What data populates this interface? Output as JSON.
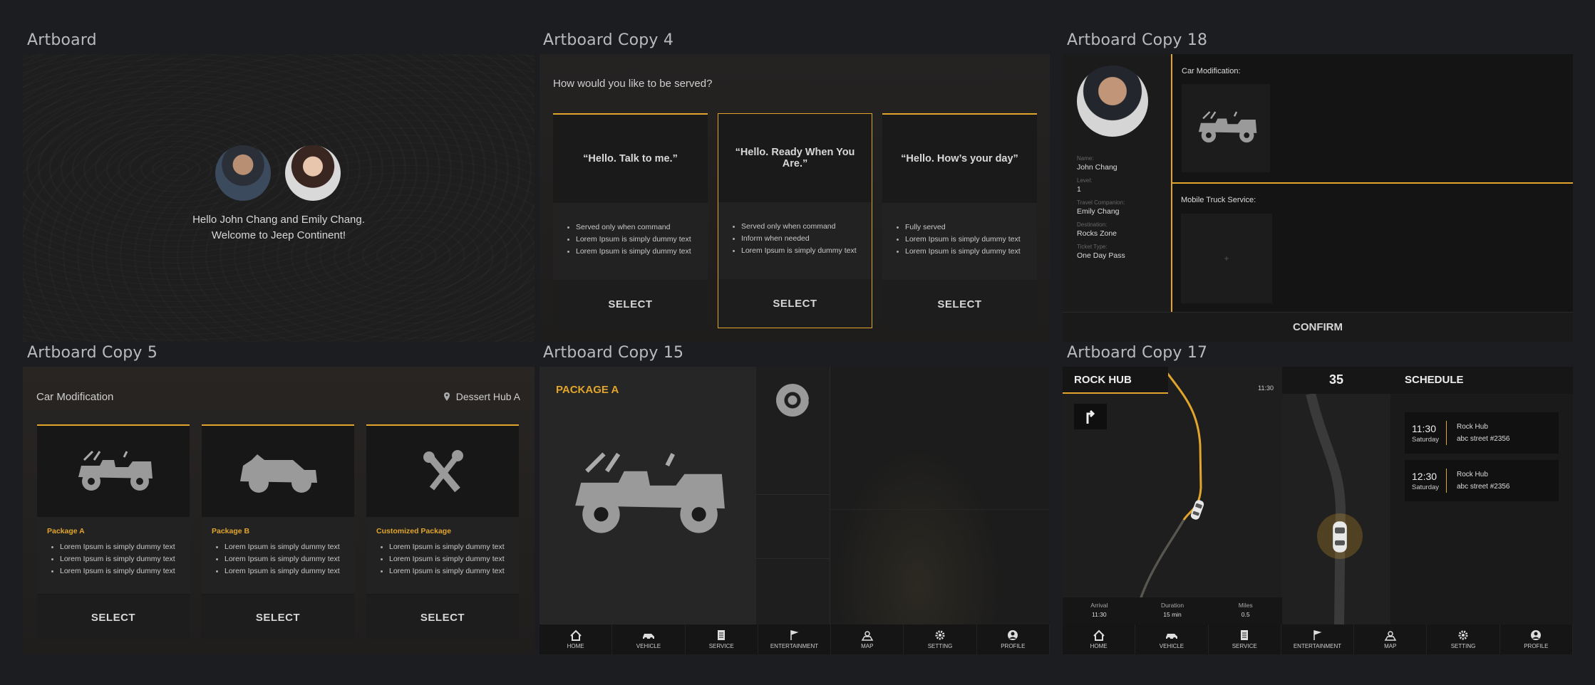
{
  "artboards": {
    "a1": {
      "title": "Artboard",
      "greeting_line1": "Hello John Chang and Emily Chang.",
      "greeting_line2": "Welcome to Jeep Continent!"
    },
    "a2": {
      "title": "Artboard Copy 4",
      "question": "How would you like to be served?",
      "cards": [
        {
          "quote": "“Hello. Talk to me.”",
          "bullets": [
            "Served only when command",
            "Lorem Ipsum is simply dummy text",
            "Lorem Ipsum is simply dummy text"
          ],
          "button": "SELECT"
        },
        {
          "quote": "“Hello. Ready When You Are.”",
          "bullets": [
            "Served only when command",
            "Inform when needed",
            "Lorem Ipsum is simply dummy text"
          ],
          "button": "SELECT"
        },
        {
          "quote": "“Hello. How’s your day”",
          "bullets": [
            "Fully served",
            "Lorem Ipsum is simply dummy text",
            "Lorem Ipsum is simply dummy text"
          ],
          "button": "SELECT"
        }
      ]
    },
    "a3": {
      "title": "Artboard Copy 18",
      "fields": [
        {
          "label": "Name:",
          "value": "John Chang"
        },
        {
          "label": "Level:",
          "value": "1"
        },
        {
          "label": "Travel Companion:",
          "value": "Emily Chang"
        },
        {
          "label": "Destination:",
          "value": "Rocks Zone"
        },
        {
          "label": "Ticket Type:",
          "value": "One Day Pass"
        }
      ],
      "car_mod_label": "Car Modification:",
      "mobile_truck_label": "Mobile Truck Service:",
      "add_symbol": "+",
      "confirm": "CONFIRM"
    },
    "a4": {
      "title": "Artboard Copy 5",
      "heading": "Car Modification",
      "location": "Dessert Hub A",
      "cards": [
        {
          "name": "Package A",
          "bullets": [
            "Lorem Ipsum is simply dummy text",
            "Lorem Ipsum is simply dummy text",
            "Lorem Ipsum is simply dummy text"
          ],
          "button": "SELECT"
        },
        {
          "name": "Package B",
          "bullets": [
            "Lorem Ipsum is simply dummy text",
            "Lorem Ipsum is simply dummy text",
            "Lorem Ipsum is simply dummy text"
          ],
          "button": "SELECT"
        },
        {
          "name": "Customized Package",
          "bullets": [
            "Lorem Ipsum is simply dummy text",
            "Lorem Ipsum is simply dummy text",
            "Lorem Ipsum is simply dummy text"
          ],
          "button": "SELECT"
        }
      ]
    },
    "a5": {
      "title": "Artboard Copy 15",
      "package": "PACKAGE A"
    },
    "a6": {
      "title": "Artboard Copy 17",
      "rock_hub": "ROCK HUB",
      "time_small": "11:30",
      "speed": "35",
      "schedule": "SCHEDULE",
      "stats": [
        {
          "label": "Arrival",
          "value": "11:30"
        },
        {
          "label": "Duration",
          "value": "15 min"
        },
        {
          "label": "Miles",
          "value": "0.5"
        }
      ],
      "schedule_items": [
        {
          "time": "11:30",
          "day": "Saturday",
          "place": "Rock Hub",
          "address": "abc street #2356"
        },
        {
          "time": "12:30",
          "day": "Saturday",
          "place": "Rock Hub",
          "address": "abc street #2356"
        }
      ]
    }
  },
  "nav": [
    {
      "label": "HOME",
      "icon": "home-icon"
    },
    {
      "label": "VEHICLE",
      "icon": "vehicle-icon"
    },
    {
      "label": "SERVICE",
      "icon": "service-icon"
    },
    {
      "label": "ENTERTAINMENT",
      "icon": "flag-icon"
    },
    {
      "label": "MAP",
      "icon": "map-icon"
    },
    {
      "label": "SETTING",
      "icon": "gear-icon"
    },
    {
      "label": "PROFILE",
      "icon": "profile-icon"
    }
  ],
  "colors": {
    "accent": "#e1a52c",
    "background": "#1c1d20"
  }
}
